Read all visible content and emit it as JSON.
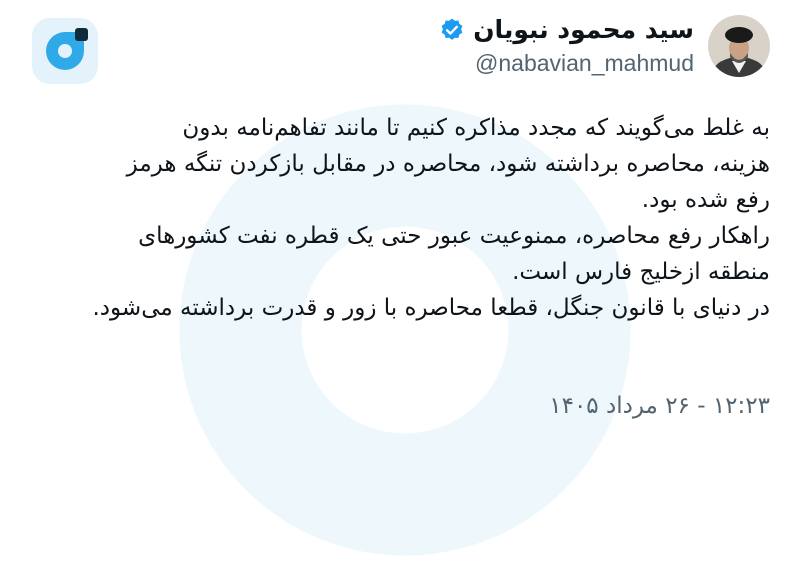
{
  "app": {
    "logo_icon": "bale-messenger-logo",
    "accent_color": "#2fa9e8"
  },
  "tweet": {
    "author": {
      "display_name": "سید محمود نبویان",
      "handle": "@nabavian_mahmud",
      "verified": true,
      "verified_color": "#1d9bf0"
    },
    "lines": [
      "به غلط می‌گویند که مجدد مذاکره کنیم تا مانند تفاهم‌نامه بدون",
      "هزینه، محاصره برداشته شود، محاصره در مقابل بازکردن تنگه هرمز",
      "رفع شده بود.",
      "راهکار رفع محاصره، ممنوعیت  عبور حتی یک قطره نفت کشورهای",
      "منطقه ازخلیج فارس است.",
      "در دنیای با قانون جنگل، قطعا محاصره با زور و قدرت برداشته می‌شود."
    ],
    "timestamp": "۱۲:۲۳ - ۲۶ مرداد ۱۴۰۵"
  }
}
